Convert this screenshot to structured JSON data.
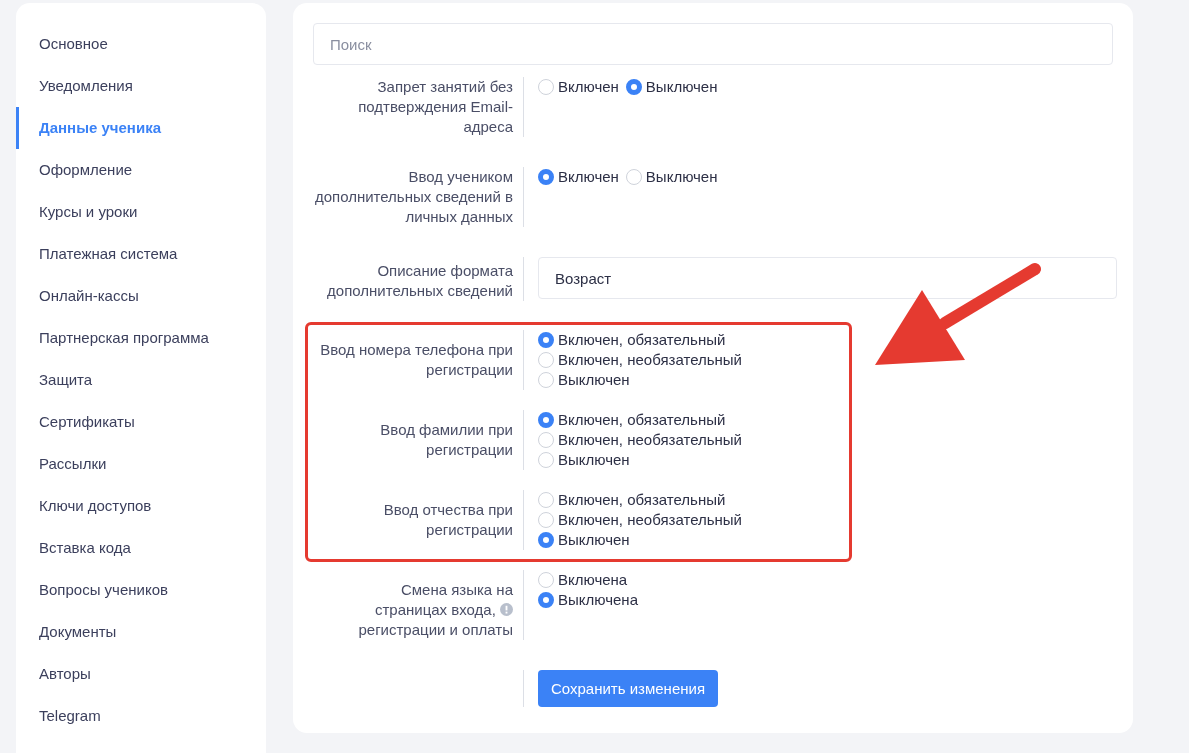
{
  "sidebar": {
    "items": [
      {
        "label": "Основное",
        "selected": false
      },
      {
        "label": "Уведомления",
        "selected": false
      },
      {
        "label": "Данные ученика",
        "selected": true
      },
      {
        "label": "Оформление",
        "selected": false
      },
      {
        "label": "Курсы и уроки",
        "selected": false
      },
      {
        "label": "Платежная система",
        "selected": false
      },
      {
        "label": "Онлайн-кассы",
        "selected": false
      },
      {
        "label": "Партнерская программа",
        "selected": false
      },
      {
        "label": "Защита",
        "selected": false
      },
      {
        "label": "Сертификаты",
        "selected": false
      },
      {
        "label": "Рассылки",
        "selected": false
      },
      {
        "label": "Ключи доступов",
        "selected": false
      },
      {
        "label": "Вставка кода",
        "selected": false
      },
      {
        "label": "Вопросы учеников",
        "selected": false
      },
      {
        "label": "Документы",
        "selected": false
      },
      {
        "label": "Авторы",
        "selected": false
      },
      {
        "label": "Telegram",
        "selected": false
      }
    ]
  },
  "search": {
    "placeholder": "Поиск"
  },
  "sections": [
    {
      "highlighted": false,
      "rows": [
        {
          "kind": "radio-inline",
          "label": [
            {
              "text": "Запрет занятий без"
            },
            {
              "text": "подтверждения Email-"
            },
            {
              "text": "адреса"
            }
          ],
          "options": [
            {
              "label": "Включен",
              "selected": false
            },
            {
              "label": "Выключен",
              "selected": true
            }
          ]
        },
        {
          "kind": "radio-inline",
          "label": [
            {
              "text": "Ввод учеником"
            },
            {
              "text": "дополнительных сведений в"
            },
            {
              "text": "личных данных"
            }
          ],
          "options": [
            {
              "label": "Включен",
              "selected": true
            },
            {
              "label": "Выключен",
              "selected": false
            }
          ]
        },
        {
          "kind": "text",
          "label": [
            {
              "text": "Описание формата"
            },
            {
              "text": "дополнительных сведений"
            }
          ],
          "value": "Возраст"
        }
      ]
    },
    {
      "highlighted": true,
      "rows": [
        {
          "kind": "radio-stacked",
          "label": [
            {
              "text": "Ввод номера телефона при"
            },
            {
              "text": "регистрации"
            }
          ],
          "options": [
            {
              "label": "Включен, обязательный",
              "selected": true
            },
            {
              "label": "Включен, необязательный",
              "selected": false
            },
            {
              "label": "Выключен",
              "selected": false
            }
          ]
        },
        {
          "kind": "radio-stacked",
          "label": [
            {
              "text": "Ввод фамилии при"
            },
            {
              "text": "регистрации"
            }
          ],
          "options": [
            {
              "label": "Включен, обязательный",
              "selected": true
            },
            {
              "label": "Включен, необязательный",
              "selected": false
            },
            {
              "label": "Выключен",
              "selected": false
            }
          ]
        },
        {
          "kind": "radio-stacked",
          "label": [
            {
              "text": "Ввод отчества при"
            },
            {
              "text": "регистрации"
            }
          ],
          "options": [
            {
              "label": "Включен, обязательный",
              "selected": false
            },
            {
              "label": "Включен, необязательный",
              "selected": false
            },
            {
              "label": "Выключен",
              "selected": true
            }
          ]
        }
      ]
    },
    {
      "highlighted": false,
      "rows": [
        {
          "kind": "radio-stacked",
          "label": [
            {
              "text": "Смена языка на"
            },
            {
              "text": "страницах входа,",
              "info": true
            },
            {
              "text": "регистрации и оплаты"
            }
          ],
          "options": [
            {
              "label": "Включена",
              "selected": false
            },
            {
              "label": "Выключена",
              "selected": true
            }
          ]
        },
        {
          "kind": "button",
          "button": "Сохранить изменения"
        }
      ]
    }
  ]
}
